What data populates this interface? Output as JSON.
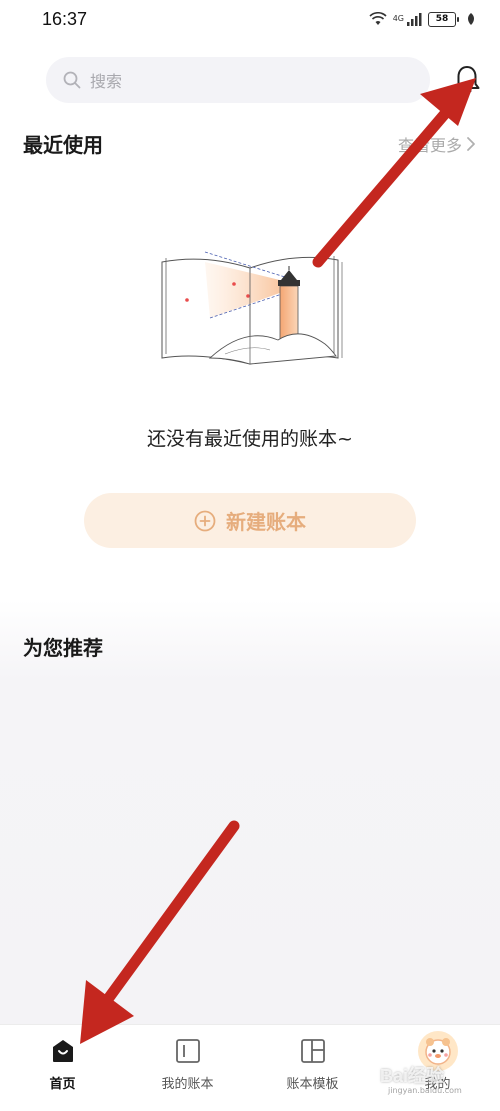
{
  "status_bar": {
    "time": "16:37",
    "network": "4G",
    "battery": "58"
  },
  "search": {
    "placeholder": "搜索"
  },
  "recent": {
    "title": "最近使用",
    "see_more": "查看更多",
    "empty_text": "还没有最近使用的账本~",
    "new_button": "新建账本"
  },
  "recommend": {
    "title": "为您推荐"
  },
  "tabs": [
    {
      "label": "首页",
      "icon": "home-icon",
      "active": true
    },
    {
      "label": "我的账本",
      "icon": "ledger-icon",
      "active": false
    },
    {
      "label": "账本模板",
      "icon": "template-icon",
      "active": false
    },
    {
      "label": "我的",
      "icon": "avatar-icon",
      "active": false
    }
  ],
  "watermark": {
    "text": "Bai经验",
    "sub": "jingyan.baidu.com"
  },
  "colors": {
    "accent": "#e6ad7d",
    "accent_bg": "#fcefe2",
    "annotation_arrow": "#c4271f"
  }
}
